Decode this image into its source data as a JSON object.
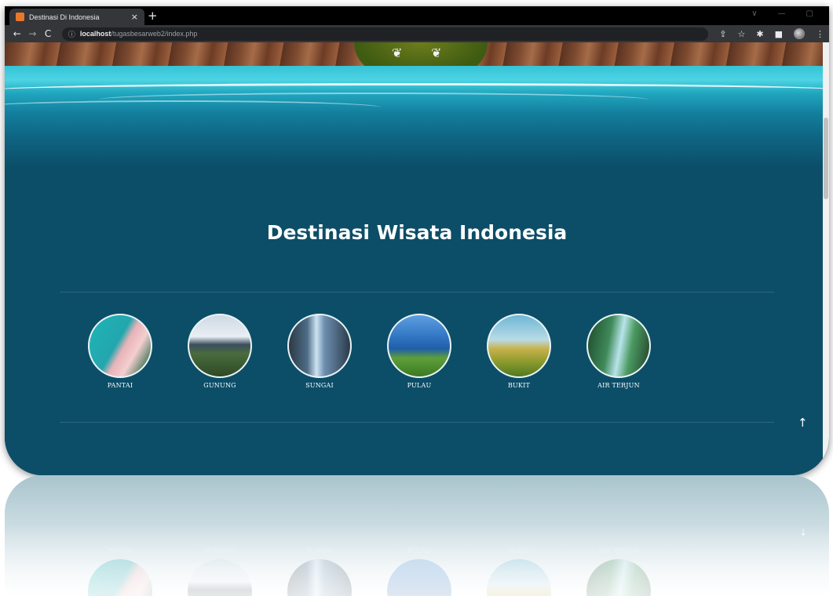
{
  "browser": {
    "tab_title": "Destinasi Di Indonesia",
    "tab_close": "×",
    "new_tab": "+",
    "url_host": "localhost",
    "url_path": "/tugasbesarweb2/index.php",
    "nav": {
      "back": "←",
      "forward": "→",
      "reload": "C"
    },
    "window_controls": {
      "minimize": "—",
      "maximize": "▢",
      "chevron": "∨"
    }
  },
  "page": {
    "section_title": "Destinasi Wisata Indonesia",
    "categories": [
      {
        "label": "PANTAI",
        "photo": "beach-photo"
      },
      {
        "label": "GUNUNG",
        "photo": "mountain-photo"
      },
      {
        "label": "SUNGAI",
        "photo": "river-photo"
      },
      {
        "label": "PULAU",
        "photo": "island-photo"
      },
      {
        "label": "BUKIT",
        "photo": "hill-photo"
      },
      {
        "label": "AIR TERJUN",
        "photo": "waterfall-photo"
      }
    ],
    "back_to_top_icon": "arrow-up-icon"
  },
  "colors": {
    "page_background": "#0c4e68",
    "water_highlight": "#4cd4e3",
    "title_text": "#ffffff"
  }
}
